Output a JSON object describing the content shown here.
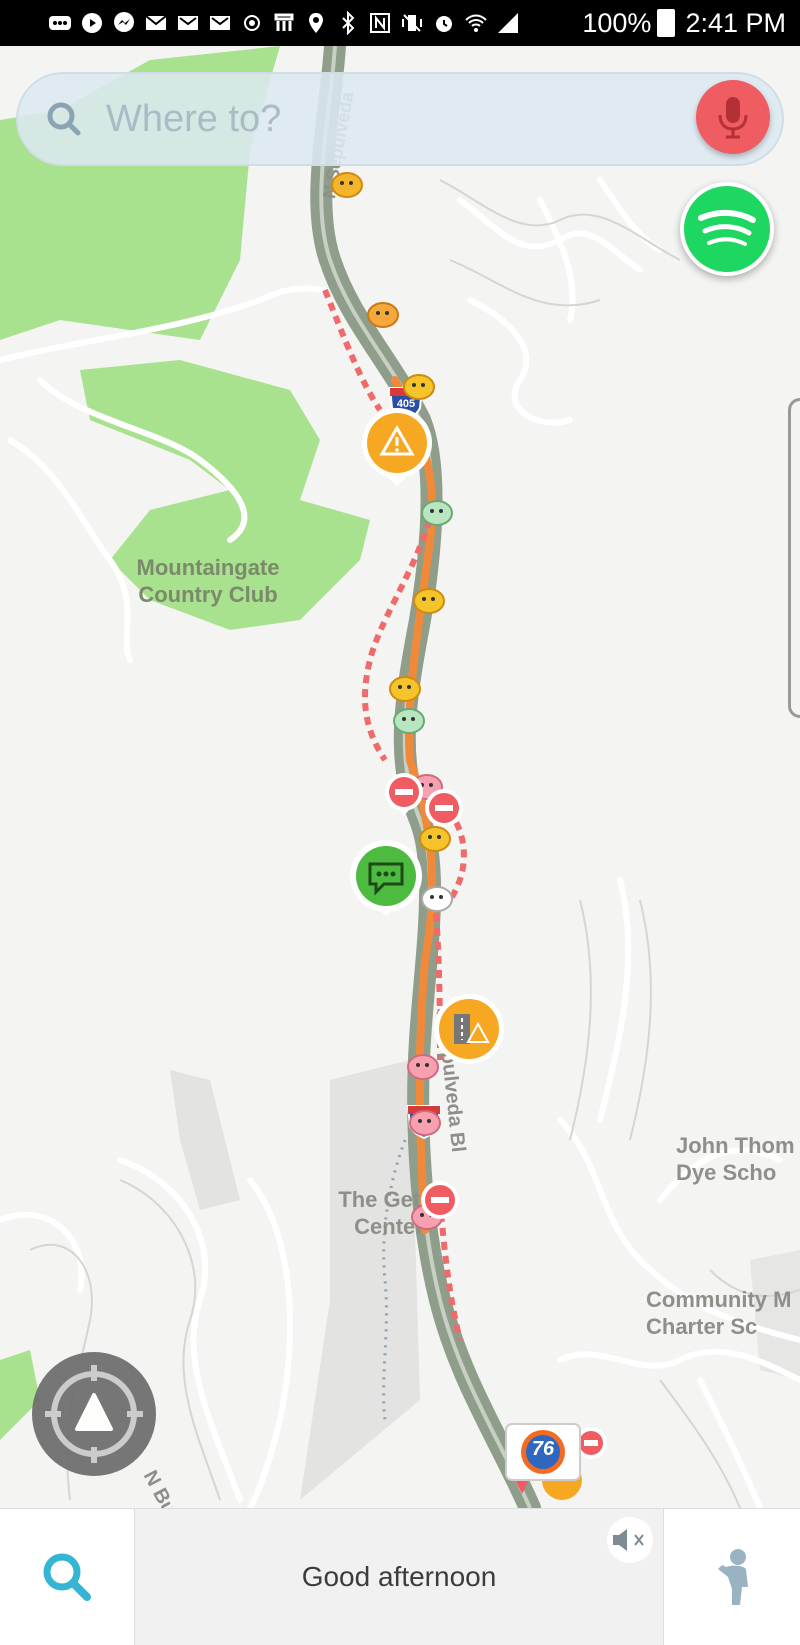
{
  "status_bar": {
    "battery": "100%",
    "time": "2:41 PM"
  },
  "search": {
    "placeholder": "Where to?"
  },
  "map": {
    "labels": {
      "country_club": "Mountaingate\nCountry Club",
      "getty": "The Getty\nCenter",
      "school1": "John Thom\nDye Scho",
      "school2": "Community M\nCharter Sc",
      "street_bundy": "N Bundy Dr",
      "street_sepulveda_top": "N Sepulveda",
      "street_sepulveda_mid": "N Sepulveda Bl",
      "highway_shield": "405",
      "gas_brand": "76"
    }
  },
  "bottom_bar": {
    "greeting": "Good afternoon"
  },
  "colors": {
    "mic": "#ef5d63",
    "spotify": "#1ed760",
    "hazard": "#f7a823",
    "chat": "#4cbb3f",
    "closure": "#ef5d63",
    "traffic": "#f08a3a",
    "search_icon": "#33b5d3"
  },
  "icons": [
    "search-icon",
    "microphone-icon",
    "spotify-icon",
    "hazard-icon",
    "road-hazard-icon",
    "chat-icon",
    "road-closure-icon",
    "recenter-icon",
    "mute-icon",
    "profile-icon"
  ]
}
